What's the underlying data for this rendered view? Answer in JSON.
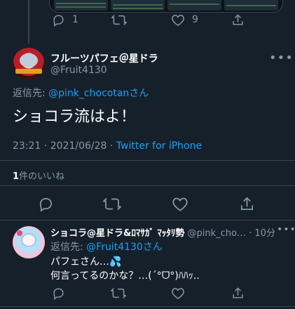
{
  "prev_tweet": {
    "actions": [
      {
        "icon": "reply-icon",
        "count": "1"
      },
      {
        "icon": "retweet-icon",
        "count": ""
      },
      {
        "icon": "like-icon",
        "count": "9"
      },
      {
        "icon": "share-icon",
        "count": ""
      }
    ]
  },
  "main_tweet": {
    "display_name": "フルーツパフェ＠星ドラ",
    "handle": "@Fruit4130",
    "reply_prefix": "返信先: ",
    "reply_to": "@pink_chocotan",
    "reply_suffix": "さん",
    "text": "ショコラ流はよ！",
    "time": "23:21",
    "dot": " · ",
    "date": "2021/06/28",
    "source": "Twitter for iPhone",
    "likes_count": "1",
    "likes_label": "件のいいね"
  },
  "reply_tweet": {
    "display_name": "ショコラ@星ドラ&ﾛﾏｻｶﾞ ﾏｯﾀﾘ勢",
    "handle": "@pink_cho…",
    "dot": " · ",
    "age": "10分",
    "reply_prefix": "返信先: ",
    "reply_to": "@Fruit4130",
    "reply_suffix": "さん",
    "line1": "パフェさん…💦",
    "line2": "何言ってるのかな？…(´°ᗜ°)ﾊﾊｯ.."
  },
  "more_label": "•••",
  "colors": {
    "background": "#15202b",
    "link": "#1da1f2",
    "muted": "#8899a6",
    "divider": "#38444d"
  }
}
